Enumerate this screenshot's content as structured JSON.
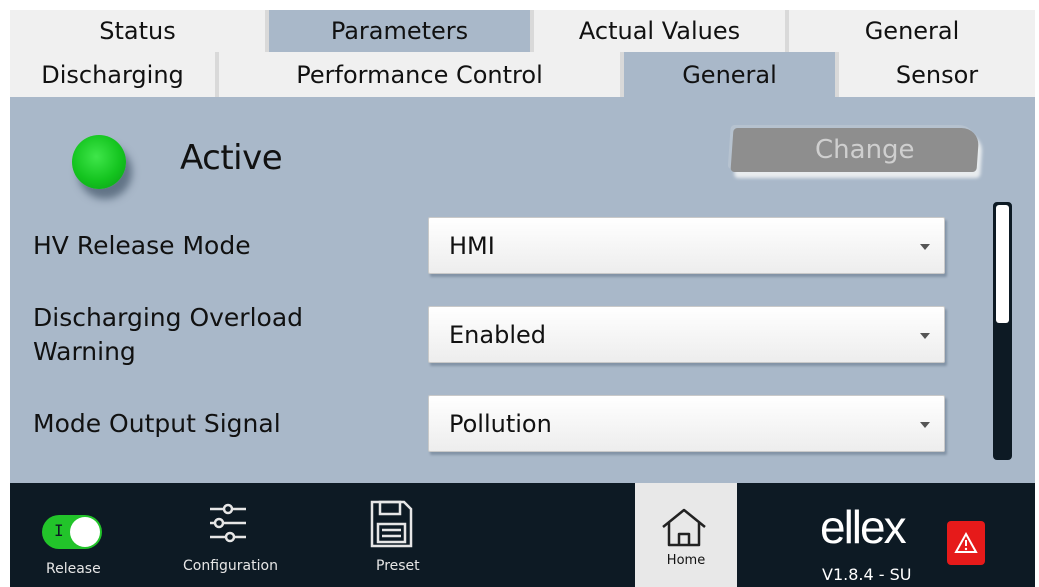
{
  "tabs_row1": [
    "Status",
    "Parameters",
    "Actual Values",
    "General"
  ],
  "tabs_row2": [
    "Discharging",
    "Performance Control",
    "General",
    "Sensor"
  ],
  "status": {
    "label": "Active",
    "indicator_color": "#14c41f"
  },
  "change_button": "Change",
  "params": [
    {
      "label": "HV Release Mode",
      "value": "HMI"
    },
    {
      "label": "Discharging Overload Warning",
      "label_line1": "Discharging Overload",
      "label_line2": "Warning",
      "value": "Enabled"
    },
    {
      "label": "Mode Output Signal",
      "value": "Pollution"
    }
  ],
  "bottombar": {
    "release": {
      "label": "Release",
      "toggle_mark": "I",
      "state": "on"
    },
    "configuration": {
      "label": "Configuration"
    },
    "preset": {
      "label": "Preset"
    },
    "home": {
      "label": "Home"
    },
    "brand": "ellex",
    "version": "V1.8.4 - SU",
    "alarm_color": "#e61a1a"
  },
  "colors": {
    "panel": "#a9b8c9",
    "bottom": "#0d1a24",
    "tab": "#f0f0f0"
  }
}
